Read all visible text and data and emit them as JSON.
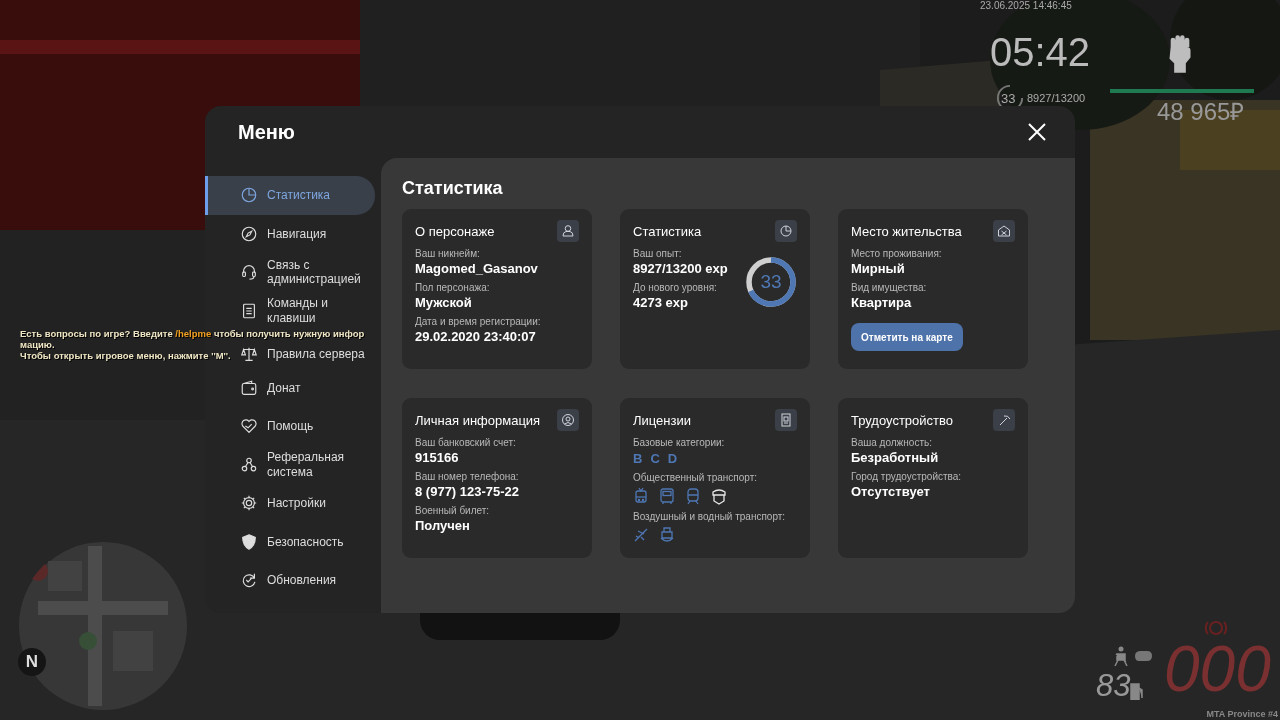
{
  "hud": {
    "datetime": "23.06.2025 14:46:45",
    "clock": "05:42",
    "level": "33",
    "experience": "8927/13200",
    "health_bar": {
      "level": 1
    },
    "money": "48 965₽",
    "speed": "83",
    "odometer": "000",
    "compass": "N",
    "server": "MTA Province #4"
  },
  "chat": [
    {
      "segments": [
        {
          "text": "Есть вопросы по игре? Введите ",
          "highlight": false
        },
        {
          "text": "/helpme",
          "highlight": true
        },
        {
          "text": " чтобы получить нужную инфор",
          "highlight": false
        }
      ]
    },
    {
      "segments": [
        {
          "text": "мацию.",
          "highlight": false
        }
      ]
    },
    {
      "segments": [
        {
          "text": "Чтобы открыть игровое меню, нажмите ''M''.",
          "highlight": false
        }
      ]
    }
  ],
  "menu": {
    "title": "Меню",
    "sidebar": [
      {
        "label": "Статистика",
        "kind": "chart",
        "selected": true
      },
      {
        "label": "Навигация",
        "kind": "compass",
        "selected": false
      },
      {
        "label": "Связь с администрацией",
        "kind": "headset",
        "selected": false
      },
      {
        "label": "Команды и клавиши",
        "kind": "document",
        "selected": false
      },
      {
        "label": "Правила сервера",
        "kind": "scales",
        "selected": false
      },
      {
        "label": "Донат",
        "kind": "wallet",
        "selected": false
      },
      {
        "label": "Помощь",
        "kind": "heart",
        "selected": false
      },
      {
        "label": "Реферальная система",
        "kind": "nodes",
        "selected": false
      },
      {
        "label": "Настройки",
        "kind": "gear",
        "selected": false
      },
      {
        "label": "Безопасность",
        "kind": "shield",
        "selected": false
      },
      {
        "label": "Обновления",
        "kind": "refresh",
        "selected": false
      }
    ],
    "page_title": "Статистика",
    "cards": [
      {
        "title": "О персонаже",
        "kind": "person",
        "fields": [
          {
            "label": "Ваш никнейм:",
            "value": "Magomed_Gasanov"
          },
          {
            "label": "Пол персонажа:",
            "value": "Мужской"
          },
          {
            "label": "Дата и время регистрации:",
            "value": "29.02.2020 23:40:07"
          }
        ]
      },
      {
        "title": "Статистика",
        "kind": "chart",
        "fields": [
          {
            "label": "Ваш опыт:",
            "value": "8927/13200 exp"
          },
          {
            "label": "До нового уровня:",
            "value": "4273 exp"
          }
        ],
        "level_ring": {
          "text": "33",
          "level": 0.68
        }
      },
      {
        "title": "Место жительства",
        "kind": "house",
        "fields": [
          {
            "label": "Место проживания:",
            "value": "Мирный"
          },
          {
            "label": "Вид имущества:",
            "value": "Квартира"
          }
        ],
        "button": "Отметить на карте"
      },
      {
        "title": "Личная информация",
        "kind": "face",
        "fields": [
          {
            "label": "Ваш банковский счет:",
            "value": "915166"
          },
          {
            "label": "Ваш номер телефона:",
            "value": "8 (977) 123-75-22"
          },
          {
            "label": "Военный билет:",
            "value": "Получен"
          }
        ]
      },
      {
        "title": "Лицензии",
        "kind": "badge",
        "licenses": {
          "categories_label": "Базовые категории:",
          "categories": [
            "B",
            "C",
            "D"
          ],
          "public_label": "Общественный транспорт:",
          "public": [
            {
              "kind": "trolleybus",
              "owned": true
            },
            {
              "kind": "bus",
              "owned": true
            },
            {
              "kind": "train",
              "owned": true
            },
            {
              "kind": "taxi",
              "owned": false
            }
          ],
          "air_water_label": "Воздушный и водный транспорт:",
          "air_water": [
            {
              "kind": "plane",
              "owned": true
            },
            {
              "kind": "ship",
              "owned": true
            }
          ]
        }
      },
      {
        "title": "Трудоустройство",
        "kind": "pickaxe",
        "fields": [
          {
            "label": "Ваша должность:",
            "value": "Безработный"
          },
          {
            "label": "Город трудоустройства:",
            "value": "Отсутствует"
          }
        ]
      }
    ]
  }
}
